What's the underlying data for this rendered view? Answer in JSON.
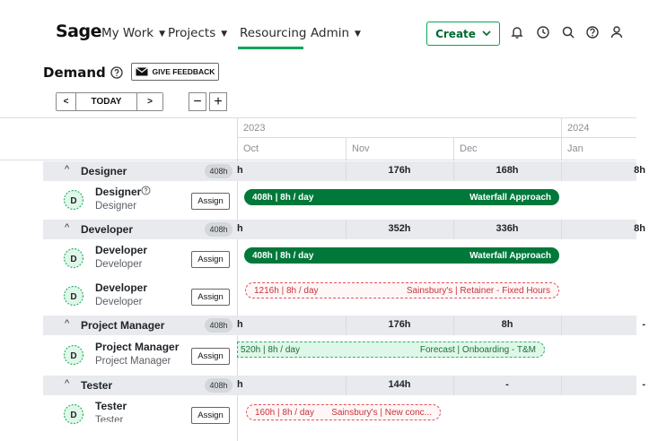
{
  "nav": {
    "logo": "Sage",
    "items": [
      {
        "label": "My Work",
        "caret": "▼"
      },
      {
        "label": "Projects",
        "caret": "▼"
      },
      {
        "label": "Resourcing",
        "caret": ""
      },
      {
        "label": "Admin",
        "caret": "▼"
      }
    ],
    "create_label": "Create",
    "icons": [
      "bell-icon",
      "clock-icon",
      "search-icon",
      "help-icon",
      "user-icon"
    ],
    "accent": "#00a65a"
  },
  "page": {
    "title": "Demand",
    "feedback_label": "GIVE FEEDBACK"
  },
  "datebar": {
    "prev": "<",
    "today": "TODAY",
    "next": ">",
    "zoom_out": "−",
    "zoom_in": "+"
  },
  "timeline": {
    "years": [
      "2023",
      "2024"
    ],
    "months": [
      "Oct",
      "Nov",
      "Dec",
      "Jan"
    ]
  },
  "groups": [
    {
      "name": "Designer",
      "hours": "408h",
      "cut": "h",
      "values": [
        "176h",
        "168h",
        "8h"
      ]
    },
    {
      "name": "Developer",
      "hours": "408h",
      "cut": "h",
      "values": [
        "352h",
        "336h",
        "8h"
      ]
    },
    {
      "name": "Project Manager",
      "hours": "408h",
      "cut": "h",
      "values": [
        "176h",
        "8h",
        "-"
      ]
    },
    {
      "name": "Tester",
      "hours": "408h",
      "cut": "h",
      "values": [
        "144h",
        "-",
        "-"
      ]
    }
  ],
  "roles": [
    {
      "avatar": "D",
      "title": "Designer",
      "subtitle": "Designer",
      "assign": "Assign",
      "bar_left": "408h | 8h / day",
      "bar_right": "Waterfall Approach",
      "bar_style": "solid"
    },
    {
      "avatar": "D",
      "title": "Developer",
      "subtitle": "Developer",
      "assign": "Assign",
      "bar_left": "408h | 8h / day",
      "bar_right": "Waterfall Approach",
      "bar_style": "solid"
    },
    {
      "avatar": "D",
      "title": "Developer",
      "subtitle": "Developer",
      "assign": "Assign",
      "bar_left": "1216h | 8h / day",
      "bar_right": "Sainsbury's | Retainer - Fixed Hours",
      "bar_style": "red"
    },
    {
      "avatar": "D",
      "title": "Project Manager",
      "subtitle": "Project Manager",
      "assign": "Assign",
      "bar_left": "520h | 8h / day",
      "bar_right": "Forecast | Onboarding - T&M",
      "bar_style": "forecast"
    },
    {
      "avatar": "D",
      "title": "Tester",
      "subtitle": "Tester",
      "assign": "Assign",
      "bar_left": "160h | 8h / day",
      "bar_right": "Sainsbury's | New conc...",
      "bar_style": "red"
    }
  ]
}
